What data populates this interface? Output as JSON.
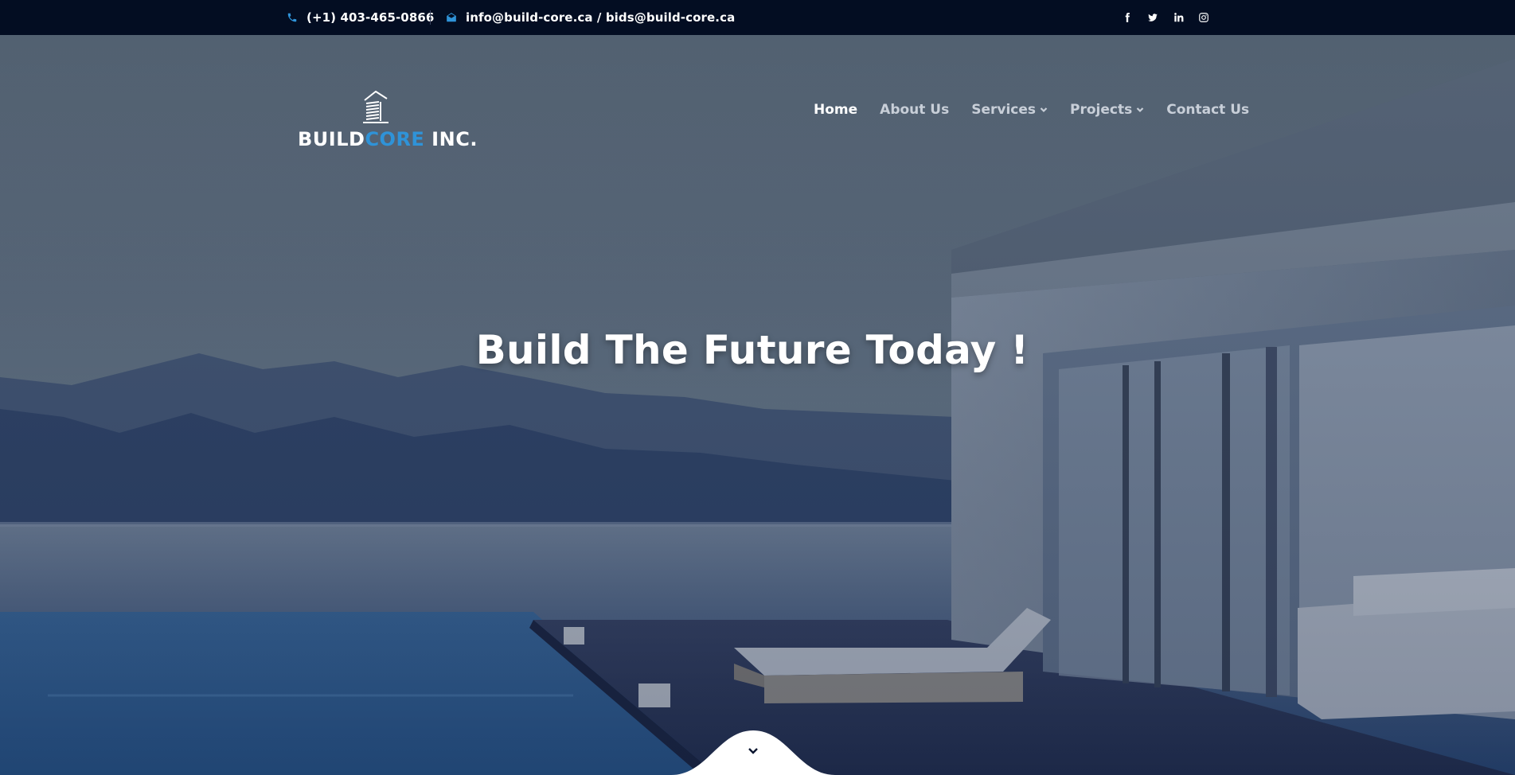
{
  "topbar": {
    "phone": "(+1) 403-465-0866",
    "email": "info@build-core.ca / bids@build-core.ca",
    "phone_icon": "phone-icon",
    "email_icon": "envelope-icon",
    "social": [
      "facebook-icon",
      "twitter-icon",
      "linkedin-icon",
      "instagram-icon"
    ]
  },
  "logo": {
    "part1": "BUILD",
    "part2": "CORE",
    "part3": " INC.",
    "icon": "building-icon"
  },
  "nav": {
    "items": [
      {
        "label": "Home",
        "active": true
      },
      {
        "label": "About Us"
      },
      {
        "label": "Services",
        "has_dropdown": true
      },
      {
        "label": "Projects",
        "has_dropdown": true
      },
      {
        "label": "Contact Us"
      }
    ]
  },
  "hero": {
    "headline": "Build The Future Today !",
    "scroll_icon": "chevron-down-icon"
  },
  "colors": {
    "topbar_bg": "#030d22",
    "accent": "#2f93d8",
    "text_light": "#ffffff"
  }
}
